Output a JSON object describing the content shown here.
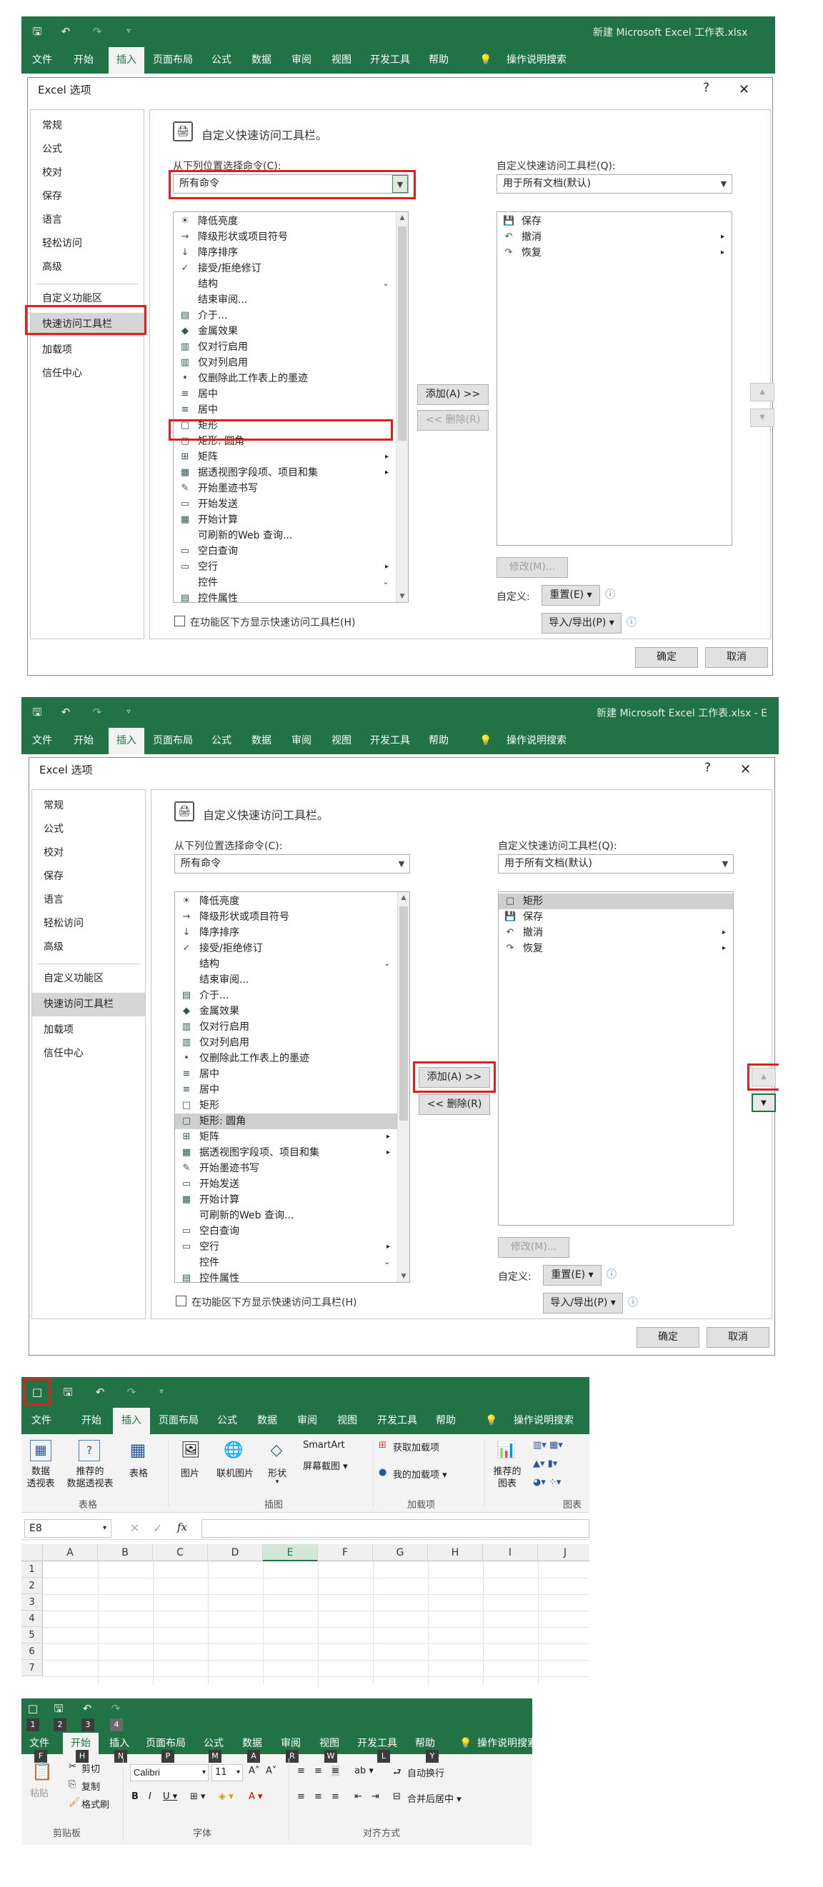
{
  "titlebar": {
    "doc_title_1": "新建 Microsoft Excel 工作表.xlsx",
    "doc_title_2": "新建 Microsoft Excel 工作表.xlsx  -  E"
  },
  "ribbon_tabs": [
    "文件",
    "开始",
    "插入",
    "页面布局",
    "公式",
    "数据",
    "审阅",
    "视图",
    "开发工具",
    "帮助"
  ],
  "tell_me": "操作说明搜索",
  "dialog": {
    "title": "Excel 选项",
    "help": "?",
    "close": "✕",
    "nav": [
      "常规",
      "公式",
      "校对",
      "保存",
      "语言",
      "轻松访问",
      "高级",
      "自定义功能区",
      "快速访问工具栏",
      "加载项",
      "信任中心"
    ],
    "heading": "自定义快速访问工具栏。",
    "choose_label": "从下列位置选择命令(C):",
    "choose_value": "所有命令",
    "customize_label": "自定义快速访问工具栏(Q):",
    "customize_value": "用于所有文档(默认)",
    "commands": [
      {
        "label": "降低亮度",
        "icon": "☀",
        "sub": ""
      },
      {
        "label": "降级形状或项目符号",
        "icon": "→",
        "sub": ""
      },
      {
        "label": "降序排序",
        "icon": "↓",
        "sub": ""
      },
      {
        "label": "接受/拒绝修订",
        "icon": "✓",
        "sub": ""
      },
      {
        "label": "结构",
        "icon": "",
        "sub": "⌄"
      },
      {
        "label": "结束审阅...",
        "icon": "",
        "sub": ""
      },
      {
        "label": "介于...",
        "icon": "▤",
        "sub": ""
      },
      {
        "label": "金属效果",
        "icon": "◆",
        "sub": ""
      },
      {
        "label": "仅对行启用",
        "icon": "▥",
        "sub": ""
      },
      {
        "label": "仅对列启用",
        "icon": "▥",
        "sub": ""
      },
      {
        "label": "仅删除此工作表上的墨迹",
        "icon": "•",
        "sub": ""
      },
      {
        "label": "居中",
        "icon": "≡",
        "sub": ""
      },
      {
        "label": "居中",
        "icon": "≡",
        "sub": ""
      },
      {
        "label": "矩形",
        "icon": "□",
        "sub": ""
      },
      {
        "label": "矩形: 圆角",
        "icon": "▢",
        "sub": ""
      },
      {
        "label": "矩阵",
        "icon": "⊞",
        "sub": "▸"
      },
      {
        "label": "据透视图字段项、项目和集",
        "icon": "▦",
        "sub": "▸"
      },
      {
        "label": "开始墨迹书写",
        "icon": "✎",
        "sub": ""
      },
      {
        "label": "开始发送",
        "icon": "▭",
        "sub": ""
      },
      {
        "label": "开始计算",
        "icon": "▦",
        "sub": ""
      },
      {
        "label": "可刷新的Web 查询...",
        "icon": "",
        "sub": ""
      },
      {
        "label": "空白查询",
        "icon": "▭",
        "sub": ""
      },
      {
        "label": "空行",
        "icon": "▭",
        "sub": "▸"
      },
      {
        "label": "控件",
        "icon": "",
        "sub": "⌄"
      },
      {
        "label": "控件属性",
        "icon": "▤",
        "sub": ""
      }
    ],
    "qat_before": [
      {
        "label": "保存",
        "icon": "💾"
      },
      {
        "label": "撤消",
        "icon": "↶"
      },
      {
        "label": "恢复",
        "icon": "↷"
      }
    ],
    "qat_after": [
      {
        "label": "矩形",
        "icon": "□"
      },
      {
        "label": "保存",
        "icon": "💾"
      },
      {
        "label": "撤消",
        "icon": "↶"
      },
      {
        "label": "恢复",
        "icon": "↷"
      }
    ],
    "add_button": "添加(A) >>",
    "remove_button": "<< 删除(R)",
    "modify_button": "修改(M)...",
    "custom_label": "自定义:",
    "reset_button": "重置(E) ▾",
    "import_export_button": "导入/导出(P) ▾",
    "show_below": "在功能区下方显示快速访问工具栏(H)",
    "ok": "确定",
    "cancel": "取消"
  },
  "insert_ribbon": {
    "buttons": [
      "数据\n透视表",
      "推荐的\n数据透视表",
      "表格",
      "图片",
      "联机图片",
      "形状",
      "SmartArt",
      "屏幕截图 ▾",
      "获取加载项",
      "我的加载项  ▾",
      "推荐的\n图表"
    ],
    "groups": [
      "表格",
      "插图",
      "加载项",
      "图表"
    ]
  },
  "formula_bar": {
    "name_box": "E8",
    "fx": "fx"
  },
  "columns": [
    "A",
    "B",
    "C",
    "D",
    "E",
    "F",
    "G",
    "H",
    "I",
    "J"
  ],
  "rows": [
    "1",
    "2",
    "3",
    "4",
    "5",
    "6",
    "7"
  ],
  "home_ribbon": {
    "keytips_qat": [
      "1",
      "2",
      "3",
      "4"
    ],
    "keytips_tabs": [
      "F",
      "H",
      "N",
      "P",
      "M",
      "A",
      "R",
      "W",
      "L",
      "Y"
    ],
    "paste": "粘贴",
    "cut": "剪切",
    "copy": "复制",
    "format_painter": "格式刷",
    "font_name": "Calibri",
    "font_size": "11",
    "wrap": "自动换行",
    "merge": "合并后居中 ▾",
    "groups": [
      "剪贴板",
      "字体",
      "对齐方式"
    ]
  }
}
